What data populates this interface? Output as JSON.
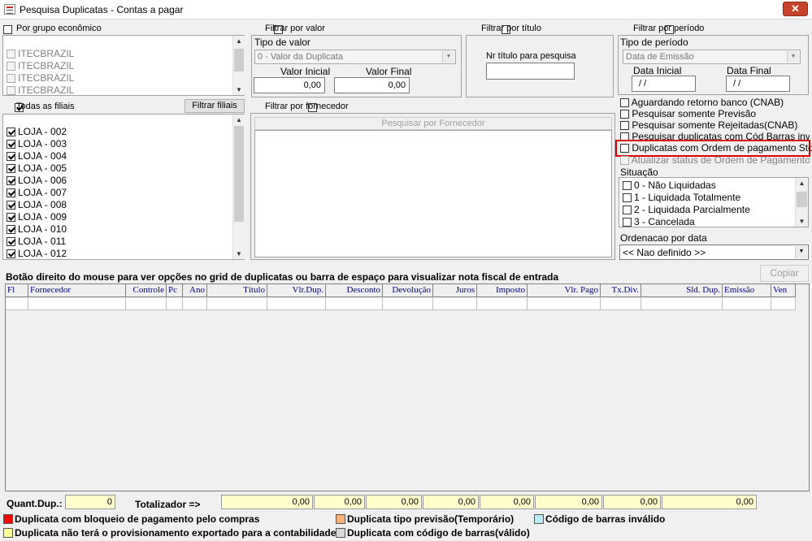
{
  "window": {
    "title": "Pesquisa Duplicatas - Contas a pagar",
    "close": "✕"
  },
  "grupo": {
    "label": "Por grupo econômico",
    "items": [
      "ITECBRAZIL",
      "ITECBRAZIL",
      "ITECBRAZIL",
      "ITECBRAZIL"
    ]
  },
  "filiais": {
    "todas_label": "Todas as filiais",
    "filtrar_btn": "Filtrar filiais",
    "items": [
      "LOJA - 002",
      "LOJA - 003",
      "LOJA - 004",
      "LOJA - 005",
      "LOJA - 006",
      "LOJA - 007",
      "LOJA - 008",
      "LOJA - 009",
      "LOJA - 010",
      "LOJA - 011",
      "LOJA - 012"
    ]
  },
  "valor": {
    "label": "Filtrar por valor",
    "tipo_label": "Tipo de valor",
    "tipo_value": "0 - Valor da Duplicata",
    "inicial_label": "Valor Inicial",
    "inicial_value": "0,00",
    "final_label": "Valor Final",
    "final_value": "0,00"
  },
  "titulo": {
    "label": "Filtrar por título",
    "nr_label": "Nr título para pesquisa",
    "nr_value": ""
  },
  "periodo": {
    "label": "Filtrar por período",
    "tipo_label": "Tipo de período",
    "tipo_value": "Data de Emissão",
    "data_inicial_label": "Data Inicial",
    "data_inicial_value": " / /",
    "data_final_label": "Data Final",
    "data_final_value": " / /"
  },
  "fornecedor": {
    "label": "Filtrar por fornecedor",
    "btn": "Pesquisar por Fornecedor"
  },
  "options": {
    "aguardando": "Aguardando retorno banco (CNAB)",
    "previsao": "Pesquisar somente Previsão",
    "rejeitadas": "Pesquisar somente Rejeitadas(CNAB)",
    "cod_barras": "Pesquisar duplicatas com Cód Barras inválido",
    "stone": "Duplicatas com Ordem de pagamento Stone",
    "atualizar": "Atualizar status de Ordem de Pagamento"
  },
  "situacao": {
    "label": "Situação",
    "items": [
      "0 - Não Liquidadas",
      "1 - Liquidada Totalmente",
      "2 - Liquidada Parcialmente",
      "3 - Cancelada"
    ]
  },
  "ordenacao": {
    "label": "Ordenacao por data",
    "value": "<< Nao definido >>"
  },
  "grid": {
    "hint": "Botão direito do mouse para ver opções no grid de duplicatas ou barra de espaço para visualizar nota fiscal de entrada",
    "copiar": "Copiar",
    "columns": [
      "Fl",
      "Fornecedor",
      "Controle",
      "Pc",
      "Ano",
      "Título",
      "Vlr.Dup.",
      "Desconto",
      "Devolução",
      "Juros",
      "Imposto",
      "Vlr. Pago",
      "Tx.Div.",
      "Sld. Dup.",
      "Emissão",
      "Ven"
    ]
  },
  "totals": {
    "quant_label": "Quant.Dup.:",
    "quant_value": "0",
    "totalizador_label": "Totalizador =>",
    "values": [
      "0,00",
      "0,00",
      "0,00",
      "0,00",
      "0,00",
      "0,00",
      "0,00",
      "0,00"
    ]
  },
  "legend": [
    {
      "color": "#ff0000",
      "text": "Duplicata com bloqueio de pagamento pelo compras"
    },
    {
      "color": "#ffff99",
      "text": "Duplicata não terá o provisionamento exportado para a contabilidade"
    },
    {
      "color": "#f9b27a",
      "text": "Duplicata tipo previsão(Temporário)"
    },
    {
      "color": "#d9d9d9",
      "text": "Duplicata com código de barras(válido)"
    },
    {
      "color": "#b8ecf6",
      "text": "Código de barras inválido"
    }
  ]
}
